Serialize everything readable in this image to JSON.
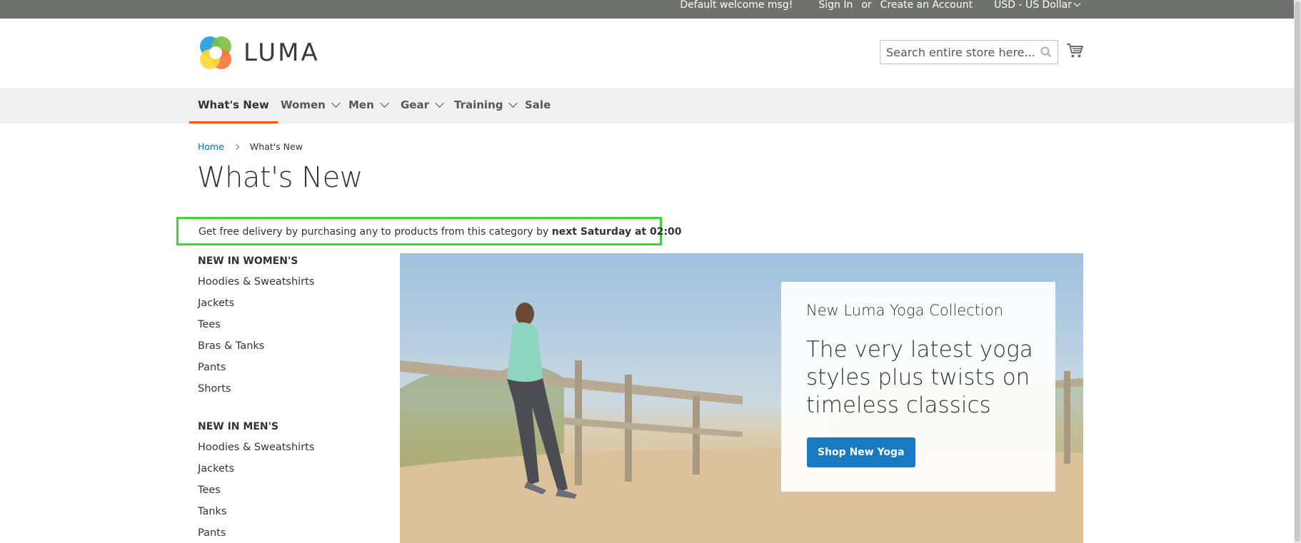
{
  "topbar": {
    "welcome": "Default welcome msg!",
    "sign_in": "Sign In",
    "or": "or",
    "create_account": "Create an Account",
    "currency": "USD - US Dollar"
  },
  "header": {
    "logo_text": "LUMA",
    "search_placeholder": "Search entire store here...",
    "search_value": ""
  },
  "nav": {
    "items": [
      {
        "label": "What's New",
        "active": true
      },
      {
        "label": "Women"
      },
      {
        "label": "Men"
      },
      {
        "label": "Gear"
      },
      {
        "label": "Training"
      },
      {
        "label": "Sale"
      }
    ]
  },
  "breadcrumb": {
    "home": "Home",
    "current": "What's New"
  },
  "page": {
    "title": "What's New"
  },
  "promo": {
    "text": "Get free delivery by purchasing any to products from this category by ",
    "emphasis": "next Saturday at 02:00",
    "highlight_color": "#3bd634"
  },
  "sidebar": {
    "groups": [
      {
        "heading": "NEW IN WOMEN'S",
        "items": [
          "Hoodies & Sweatshirts",
          "Jackets",
          "Tees",
          "Bras & Tanks",
          "Pants",
          "Shorts"
        ]
      },
      {
        "heading": "NEW IN MEN'S",
        "items": [
          "Hoodies & Sweatshirts",
          "Jackets",
          "Tees",
          "Tanks",
          "Pants"
        ]
      }
    ]
  },
  "hero": {
    "kicker": "New Luma Yoga Collection",
    "headline": "The very latest yoga styles plus twists on timeless classics",
    "button_label": "Shop New Yoga",
    "button_color": "#1979c3"
  },
  "colors": {
    "topbar": "#6e716e",
    "nav_bg": "#f0f0f0",
    "nav_active_underline": "#ff5501",
    "link": "#006bb4"
  }
}
